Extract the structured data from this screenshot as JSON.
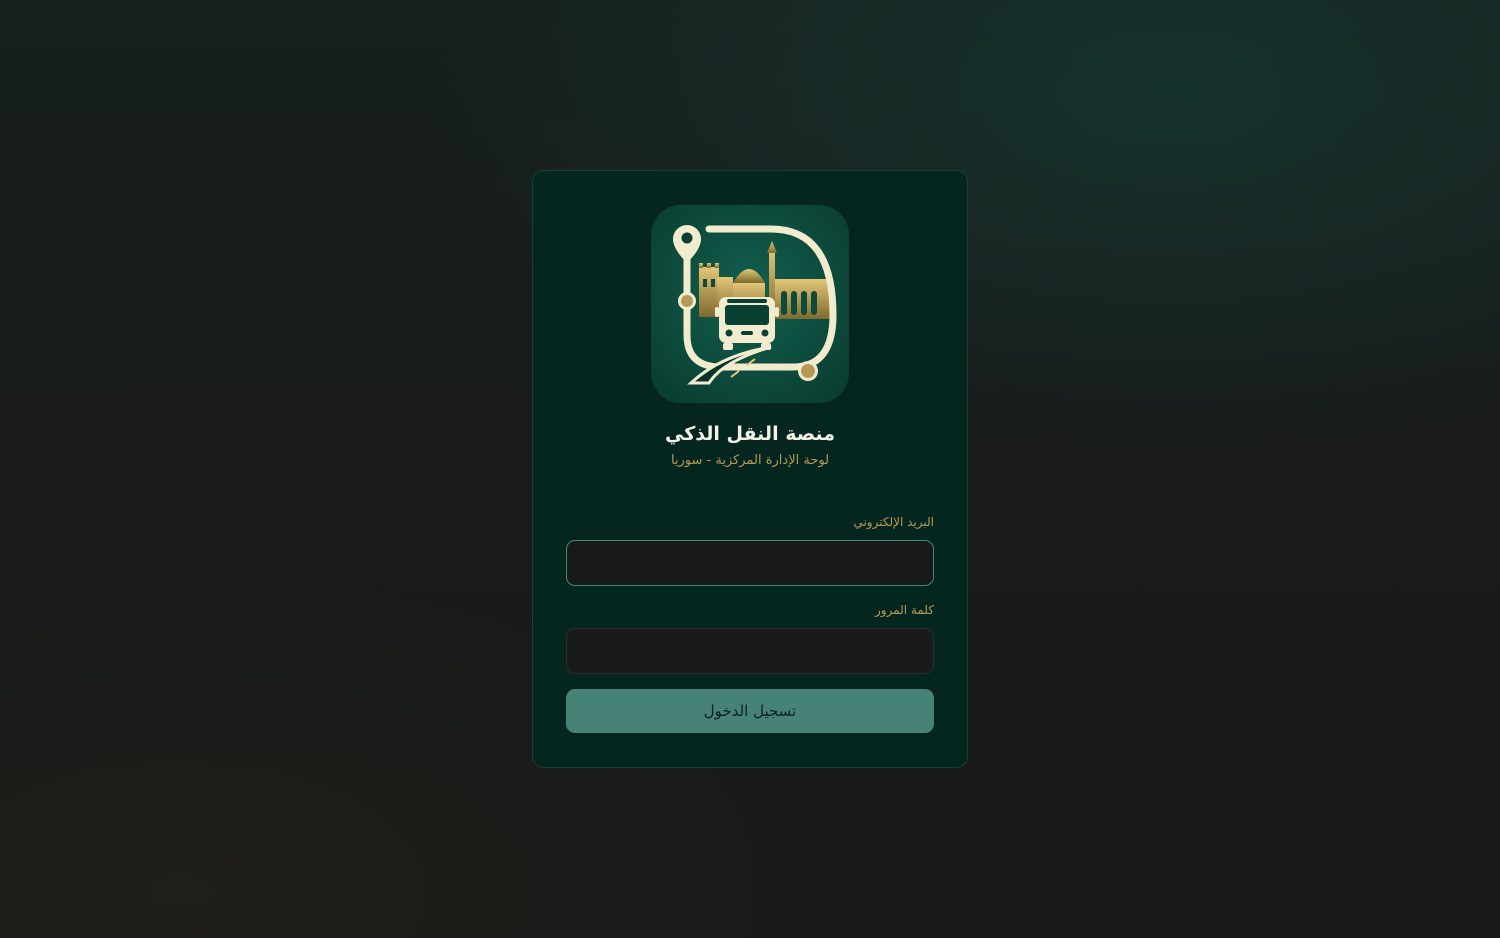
{
  "header": {
    "title": "منصة النقل الذكي",
    "subtitle": "لوحة الإدارة المركزية - سوريا"
  },
  "form": {
    "email_label": "البريد الإلكتروني",
    "email_value": "",
    "password_label": "كلمة المرور",
    "password_value": "",
    "submit_label": "تسجيل الدخول"
  },
  "logo": {
    "icon": "bus-route-mosque-logo-icon"
  },
  "colors": {
    "card_background": "#04261f",
    "accent_gold": "#b59a55",
    "button_teal": "#468276",
    "input_background": "#181a19",
    "input_focus_border": "#3f8a76"
  }
}
